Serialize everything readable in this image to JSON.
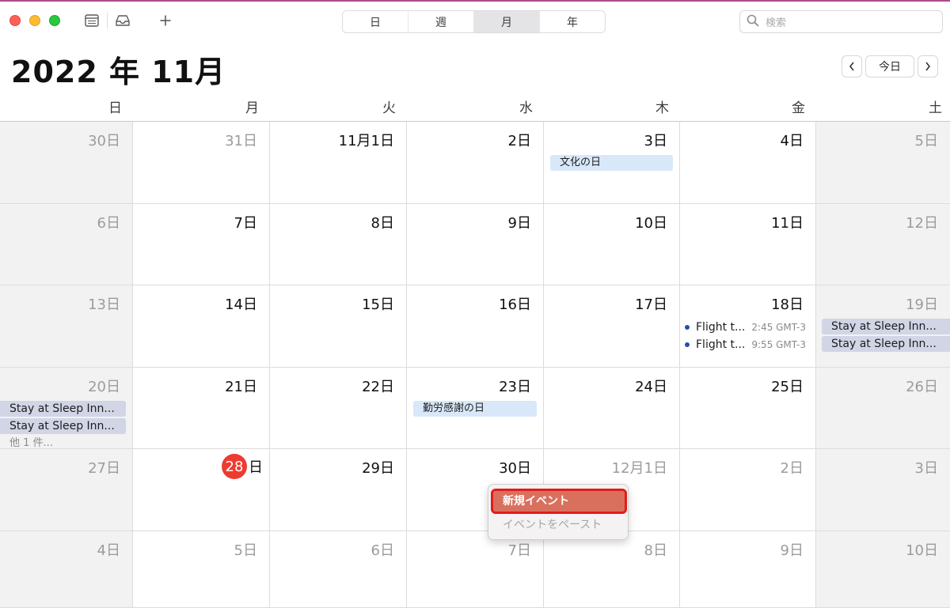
{
  "toolbar": {
    "views": [
      {
        "label": "日",
        "active": false
      },
      {
        "label": "週",
        "active": false
      },
      {
        "label": "月",
        "active": true
      },
      {
        "label": "年",
        "active": false
      }
    ],
    "search_placeholder": "検索",
    "icons": {
      "calendars": "sidebar-icon",
      "inbox": "inbox-icon",
      "add": "plus-icon",
      "search": "search-icon"
    }
  },
  "header": {
    "month_title": "2022 年 11月",
    "prev": "<",
    "today": "今日",
    "next": ">"
  },
  "weekdays": [
    "日",
    "月",
    "火",
    "水",
    "木",
    "金",
    "土"
  ],
  "weeks": [
    [
      {
        "label": "30日",
        "dim": true
      },
      {
        "label": "31日",
        "dim": true
      },
      {
        "label": "11月1日"
      },
      {
        "label": "2日"
      },
      {
        "label": "3日",
        "events": [
          {
            "kind": "holiday",
            "title": "文化の日"
          }
        ]
      },
      {
        "label": "4日"
      },
      {
        "label": "5日"
      }
    ],
    [
      {
        "label": "6日"
      },
      {
        "label": "7日"
      },
      {
        "label": "8日"
      },
      {
        "label": "9日"
      },
      {
        "label": "10日"
      },
      {
        "label": "11日"
      },
      {
        "label": "12日"
      }
    ],
    [
      {
        "label": "13日"
      },
      {
        "label": "14日"
      },
      {
        "label": "15日"
      },
      {
        "label": "16日"
      },
      {
        "label": "17日"
      },
      {
        "label": "18日",
        "events": [
          {
            "kind": "flight",
            "title": "Flight t...",
            "time": "2:45 GMT-3"
          },
          {
            "kind": "flight",
            "title": "Flight t...",
            "time": "9:55 GMT-3"
          }
        ]
      },
      {
        "label": "19日",
        "events": [
          {
            "kind": "stay",
            "title": "Stay at Sleep Inn..."
          },
          {
            "kind": "stay",
            "title": "Stay at Sleep Inn..."
          }
        ]
      }
    ],
    [
      {
        "label": "20日",
        "events": [
          {
            "kind": "stay",
            "title": "Stay at Sleep Inn..."
          },
          {
            "kind": "stay",
            "title": "Stay at Sleep Inn..."
          }
        ],
        "more": "他 1 件..."
      },
      {
        "label": "21日"
      },
      {
        "label": "22日"
      },
      {
        "label": "23日",
        "events": [
          {
            "kind": "holiday",
            "title": "勤労感謝の日"
          }
        ]
      },
      {
        "label": "24日"
      },
      {
        "label": "25日"
      },
      {
        "label": "26日"
      }
    ],
    [
      {
        "label": "27日"
      },
      {
        "label": "日",
        "today": true,
        "today_num": "28"
      },
      {
        "label": "29日"
      },
      {
        "label": "30日"
      },
      {
        "label": "12月1日",
        "dim": true
      },
      {
        "label": "2日",
        "dim": true
      },
      {
        "label": "3日",
        "dim": true
      }
    ],
    [
      {
        "label": "4日",
        "dim": true
      },
      {
        "label": "5日",
        "dim": true
      },
      {
        "label": "6日",
        "dim": true
      },
      {
        "label": "7日",
        "dim": true
      },
      {
        "label": "8日",
        "dim": true
      },
      {
        "label": "9日",
        "dim": true
      },
      {
        "label": "10日",
        "dim": true
      }
    ]
  ],
  "context_menu": {
    "new_event": "新規イベント",
    "paste_event": "イベントをペースト"
  }
}
